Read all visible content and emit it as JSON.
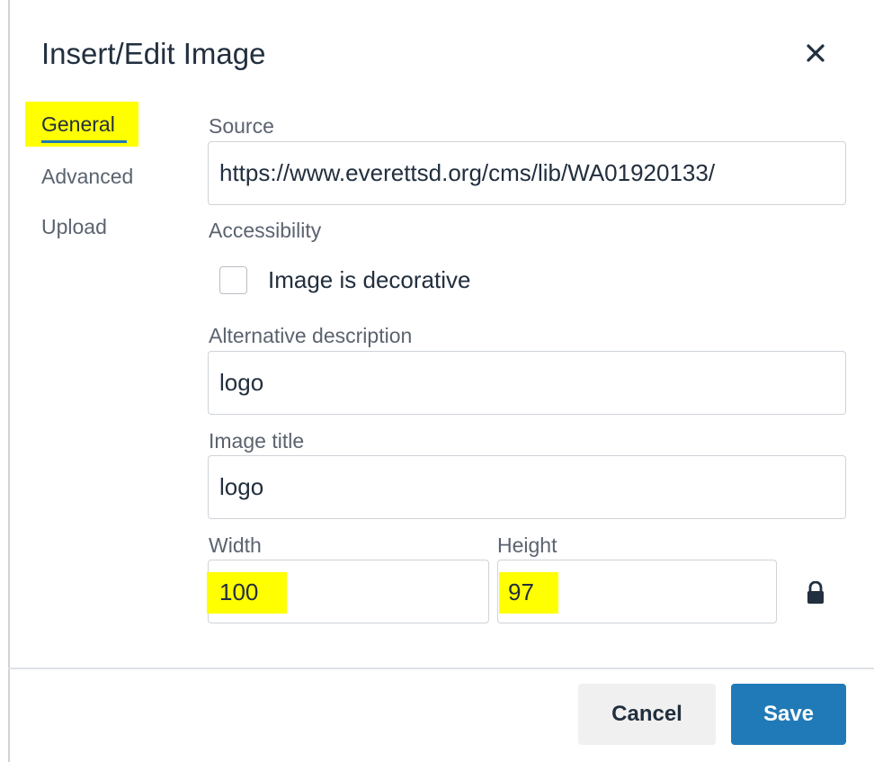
{
  "dialog": {
    "title": "Insert/Edit Image"
  },
  "tabs": [
    {
      "label": "General",
      "active": true
    },
    {
      "label": "Advanced",
      "active": false
    },
    {
      "label": "Upload",
      "active": false
    }
  ],
  "form": {
    "source_label": "Source",
    "source_value": "https://www.everettsd.org/cms/lib/WA01920133/",
    "accessibility_label": "Accessibility",
    "decorative_label": "Image is decorative",
    "decorative_checked": false,
    "alt_label": "Alternative description",
    "alt_value": "logo",
    "title_label": "Image title",
    "title_value": "logo",
    "width_label": "Width",
    "width_value": "100",
    "height_label": "Height",
    "height_value": "97"
  },
  "buttons": {
    "cancel": "Cancel",
    "save": "Save"
  },
  "icons": {
    "close": "close-icon",
    "lock": "lock-icon"
  },
  "colors": {
    "highlight": "#ffff00",
    "primary": "#207ab7"
  }
}
